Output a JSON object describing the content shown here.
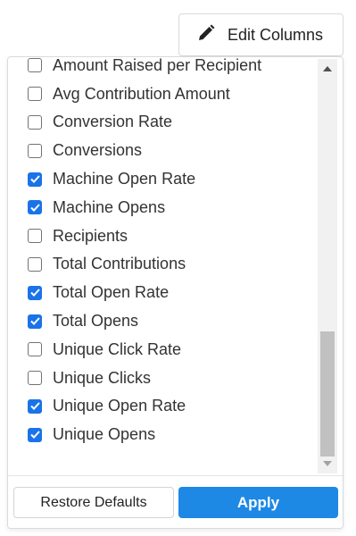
{
  "header": {
    "edit_columns_label": "Edit Columns",
    "edit_icon": "pencil-icon"
  },
  "columns": {
    "items": [
      {
        "label": "Amount Raised per Recipient",
        "checked": false
      },
      {
        "label": "Avg Contribution Amount",
        "checked": false
      },
      {
        "label": "Conversion Rate",
        "checked": false
      },
      {
        "label": "Conversions",
        "checked": false
      },
      {
        "label": "Machine Open Rate",
        "checked": true
      },
      {
        "label": "Machine Opens",
        "checked": true
      },
      {
        "label": "Recipients",
        "checked": false
      },
      {
        "label": "Total Contributions",
        "checked": false
      },
      {
        "label": "Total Open Rate",
        "checked": true
      },
      {
        "label": "Total Opens",
        "checked": true
      },
      {
        "label": "Unique Click Rate",
        "checked": false
      },
      {
        "label": "Unique Clicks",
        "checked": false
      },
      {
        "label": "Unique Open Rate",
        "checked": true
      },
      {
        "label": "Unique Opens",
        "checked": true
      }
    ]
  },
  "footer": {
    "restore_label": "Restore Defaults",
    "apply_label": "Apply"
  },
  "colors": {
    "accent": "#1a73e8",
    "apply_button": "#1e88e5"
  }
}
